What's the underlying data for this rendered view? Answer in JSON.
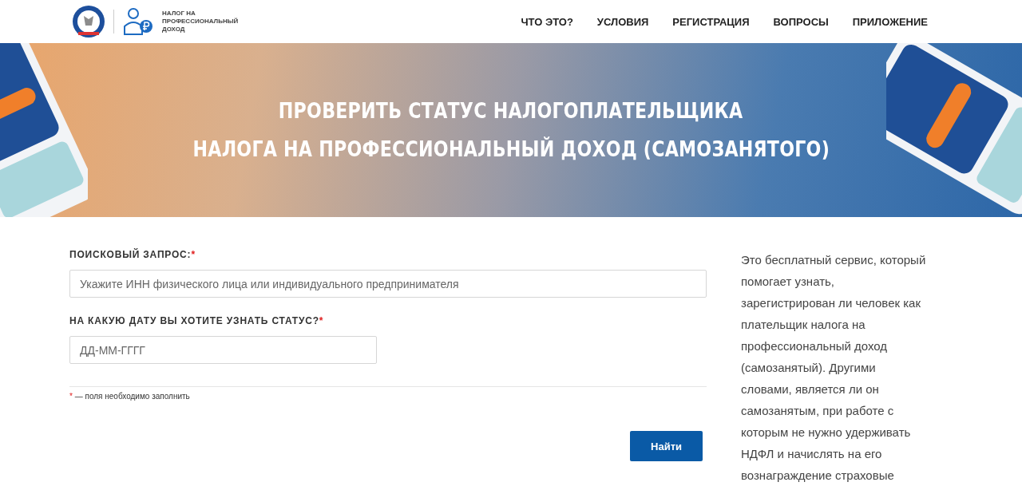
{
  "header": {
    "logo_text": "НАЛОГ НА ПРОФЕССИОНАЛЬНЫЙ ДОХОД",
    "nav": [
      {
        "label": "ЧТО ЭТО?"
      },
      {
        "label": "УСЛОВИЯ"
      },
      {
        "label": "РЕГИСТРАЦИЯ"
      },
      {
        "label": "ВОПРОСЫ"
      },
      {
        "label": "ПРИЛОЖЕНИЕ"
      }
    ]
  },
  "banner": {
    "title_lines": [
      "ПРОВЕРИТЬ СТАТУС НАЛОГОПЛАТЕЛЬЩИКА",
      "НАЛОГА НА ПРОФЕССИОНАЛЬНЫЙ ДОХОД (САМОЗАНЯТОГО)"
    ]
  },
  "form": {
    "fields": [
      {
        "label": "ПОИСКОВЫЙ ЗАПРОС:",
        "required_mark": "*",
        "placeholder": "Укажите ИНН физического лица или индивидуального предпринимателя",
        "kind": "wide"
      },
      {
        "label": "НА КАКУЮ ДАТУ ВЫ ХОТИТЕ УЗНАТЬ СТАТУС?",
        "required_mark": "*",
        "placeholder": "ДД-ММ-ГГГГ",
        "kind": "narrow"
      }
    ],
    "note_mark": "*",
    "note": "— поля необходимо заполнить",
    "submit": "Найти"
  },
  "sidebar": {
    "text": "Это бесплатный сервис, который помогает узнать, зарегистрирован ли человек как плательщик налога на профессиональный доход (самозанятый). Другими словами, является ли он самозанятым, при работе с которым не нужно удерживать НДФЛ и начислять на его вознаграждение страховые"
  }
}
